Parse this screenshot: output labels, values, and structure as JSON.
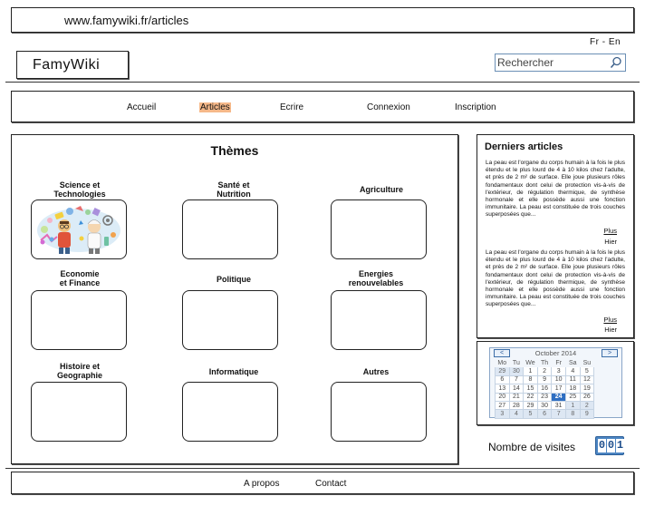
{
  "browser": {
    "url": "www.famywiki.fr/articles"
  },
  "lang": {
    "label": "Fr - En"
  },
  "logo": {
    "text": "FamyWiki"
  },
  "search": {
    "placeholder": "Rechercher"
  },
  "nav": {
    "items": [
      {
        "label": "Accueil",
        "active": false
      },
      {
        "label": "Articles",
        "active": true
      },
      {
        "label": "Ecrire",
        "active": false
      },
      {
        "label": "Connexion",
        "active": false
      },
      {
        "label": "Inscription",
        "active": false
      }
    ]
  },
  "themes": {
    "title": "Thèmes",
    "items": [
      {
        "label": "Science et\nTechnologies",
        "icon": "science-illustration"
      },
      {
        "label": "Santé et\nNutrition"
      },
      {
        "label": "Agriculture"
      },
      {
        "label": "Economie\net Finance"
      },
      {
        "label": "Politique"
      },
      {
        "label": "Energies\nrenouvelables"
      },
      {
        "label": "Histoire et\nGeographie"
      },
      {
        "label": "Informatique"
      },
      {
        "label": "Autres"
      }
    ]
  },
  "latest": {
    "title": "Derniers articles",
    "articles": [
      {
        "excerpt": "La peau est l'organe du corps humain à la fois le plus étendu et le plus lourd de 4 à 10 kilos chez l'adulte, et près de 2 m² de surface. Elle joue plusieurs rôles fondamentaux dont celui de protection vis-à-vis de l'extérieur, de régulation thermique, de synthèse hormonale et elle possède aussi une fonction immunitaire. La peau est constituée de trois couches superposées que...",
        "more": "Plus",
        "when": "Hier"
      },
      {
        "excerpt": "La peau est l'organe du corps humain à la fois le plus étendu et le plus lourd de 4 à 10 kilos chez l'adulte, et près de 2 m² de surface. Elle joue plusieurs rôles fondamentaux dont celui de protection vis-à-vis de l'extérieur, de régulation thermique, de synthèse hormonale et elle possède aussi une fonction immunitaire. La peau est constituée de trois couches superposées que...",
        "more": "Plus",
        "when": "Hier"
      }
    ]
  },
  "calendar": {
    "month": "October 2014",
    "prev": "<",
    "next": ">",
    "days": [
      "Mo",
      "Tu",
      "We",
      "Th",
      "Fr",
      "Sa",
      "Su"
    ],
    "weeks": [
      [
        "29",
        "30",
        "1",
        "2",
        "3",
        "4",
        "5"
      ],
      [
        "6",
        "7",
        "8",
        "9",
        "10",
        "11",
        "12"
      ],
      [
        "13",
        "14",
        "15",
        "16",
        "17",
        "18",
        "19"
      ],
      [
        "20",
        "21",
        "22",
        "23",
        "24",
        "25",
        "26"
      ],
      [
        "27",
        "28",
        "29",
        "30",
        "31",
        "1",
        "2"
      ],
      [
        "3",
        "4",
        "5",
        "6",
        "7",
        "8",
        "9"
      ]
    ],
    "today": "24"
  },
  "visits": {
    "label": "Nombre de visites",
    "digits": [
      "0",
      "0",
      "1"
    ]
  },
  "footer": {
    "links": [
      "A propos",
      "Contact"
    ]
  },
  "colors": {
    "active_nav": "#f6b98a",
    "accent": "#4d86c3",
    "today": "#2f6fc2"
  }
}
